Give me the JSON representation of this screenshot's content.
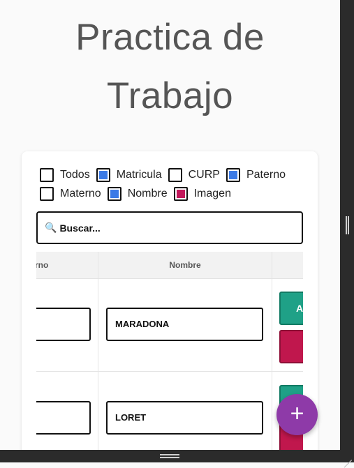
{
  "title": {
    "line1": "Practica de",
    "line2": "Trabajo"
  },
  "filters": [
    {
      "label": "Todos",
      "checked": false
    },
    {
      "label": "Matricula",
      "checked": true
    },
    {
      "label": "CURP",
      "checked": false
    },
    {
      "label": "Paterno",
      "checked": true
    },
    {
      "label": "Materno",
      "checked": false
    },
    {
      "label": "Nombre",
      "checked": true
    },
    {
      "label": "Imagen",
      "checked": true
    }
  ],
  "search": {
    "icon": "search-icon",
    "placeholder": "Buscar..."
  },
  "table": {
    "headers": {
      "paterno_partial": "rno",
      "nombre": "Nombre"
    },
    "rows": [
      {
        "nombre": "MARADONA",
        "action_label": "A"
      },
      {
        "nombre": "LORET",
        "action_label": ""
      }
    ]
  },
  "fab": {
    "icon": "plus-icon",
    "label": "+"
  },
  "colors": {
    "checked": "#3b7ae6",
    "image_checked": "#c2185b",
    "teal": "#1fa187",
    "red": "#c0174d",
    "fab": "#8e3aa8"
  }
}
